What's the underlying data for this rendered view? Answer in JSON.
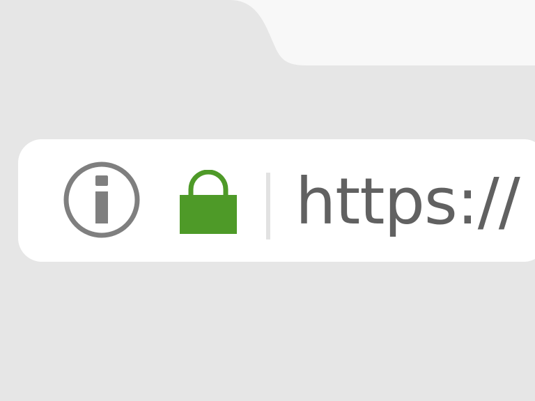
{
  "address_bar": {
    "url_text": "https://",
    "info_icon": "info-icon",
    "lock_icon": "lock-icon"
  },
  "colors": {
    "background": "#e6e6e6",
    "tab": "#f8f8f8",
    "address_bar": "#ffffff",
    "lock": "#4e9a28",
    "info_icon": "#7f7f7f",
    "divider": "#e2e2e2",
    "url_text": "#616161"
  }
}
